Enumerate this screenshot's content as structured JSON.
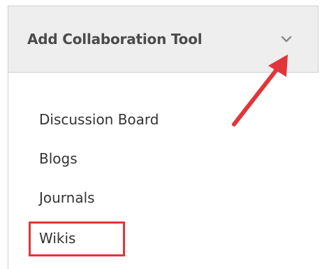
{
  "menu": {
    "title": "Add Collaboration Tool",
    "chevron_icon": "chevron-down-icon",
    "items": [
      {
        "label": "Discussion Board"
      },
      {
        "label": "Blogs"
      },
      {
        "label": "Journals"
      },
      {
        "label": "Wikis",
        "highlighted": true
      }
    ]
  },
  "annotations": {
    "arrow_color": "#e2353a",
    "highlight_color": "#e2353a"
  }
}
